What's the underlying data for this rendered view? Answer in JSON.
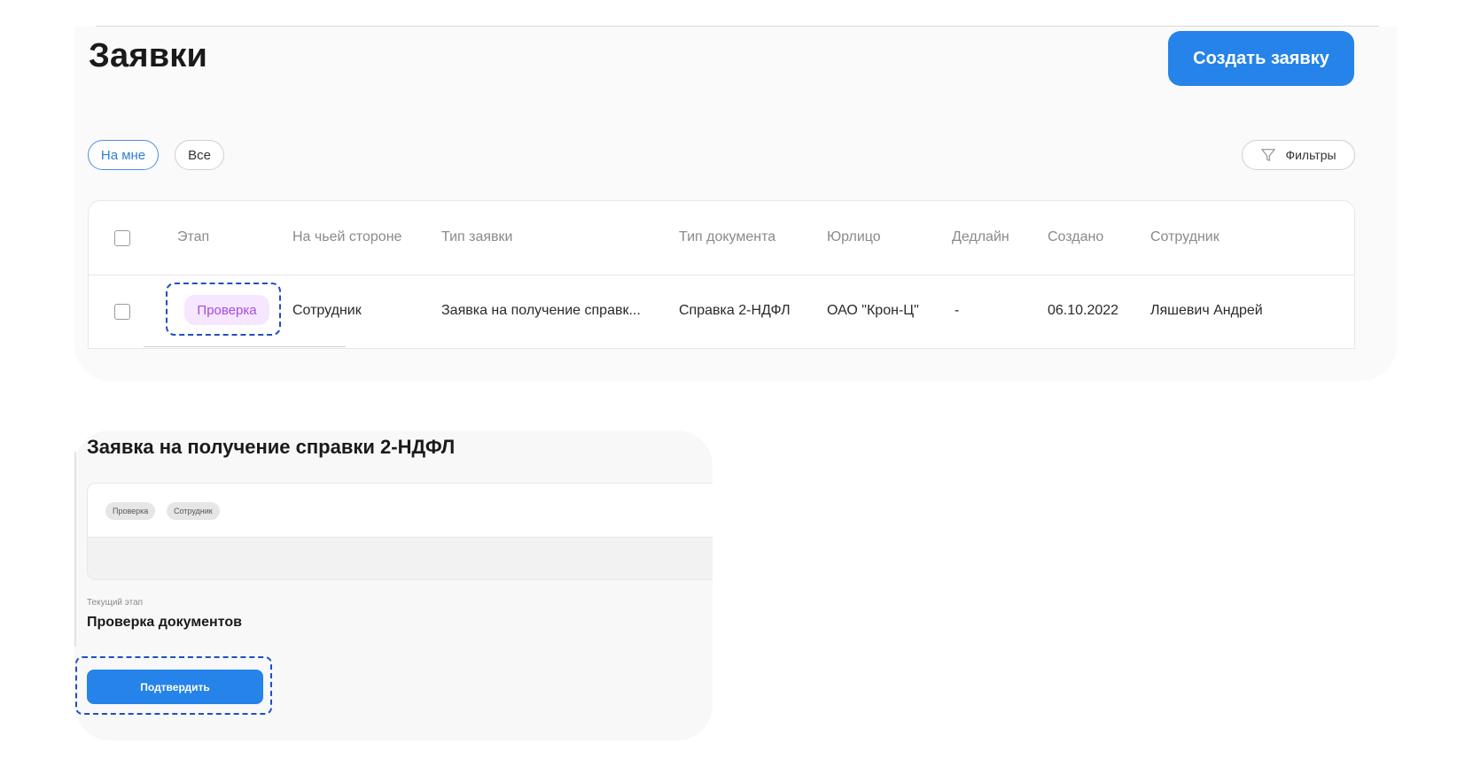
{
  "header": {
    "title": "Заявки",
    "create_button_label": "Создать заявку"
  },
  "filters": {
    "chips": [
      {
        "label": "На мне",
        "selected": true
      },
      {
        "label": "Все",
        "selected": false
      }
    ],
    "filters_button_label": "Фильтры",
    "filters_icon": "funnel-icon"
  },
  "table": {
    "columns": [
      "Этап",
      "На чьей стороне",
      "Тип заявки",
      "Тип документа",
      "Юрлицо",
      "Дедлайн",
      "Создано",
      "Сотрудник"
    ],
    "rows": [
      {
        "stage": "Проверка",
        "side": "Сотрудник",
        "request_type": "Заявка на получение справк...",
        "document_type": "Справка 2-НДФЛ",
        "legal_entity": "ОАО \"Крон-Ц\"",
        "deadline": "-",
        "created": "06.10.2022",
        "employee": "Ляшевич Андрей"
      }
    ]
  },
  "detail": {
    "title": "Заявка на получение справки 2-НДФЛ",
    "tags": [
      "Проверка",
      "Сотрудник"
    ],
    "current_stage_label": "Текущий этап",
    "current_stage_value": "Проверка документов",
    "confirm_button_label": "Подтвердить"
  },
  "colors": {
    "accent": "#2583e9",
    "stage_badge_bg": "#f6e6ff",
    "stage_badge_text": "#a84ae0",
    "highlight": "#1f4fc2"
  }
}
